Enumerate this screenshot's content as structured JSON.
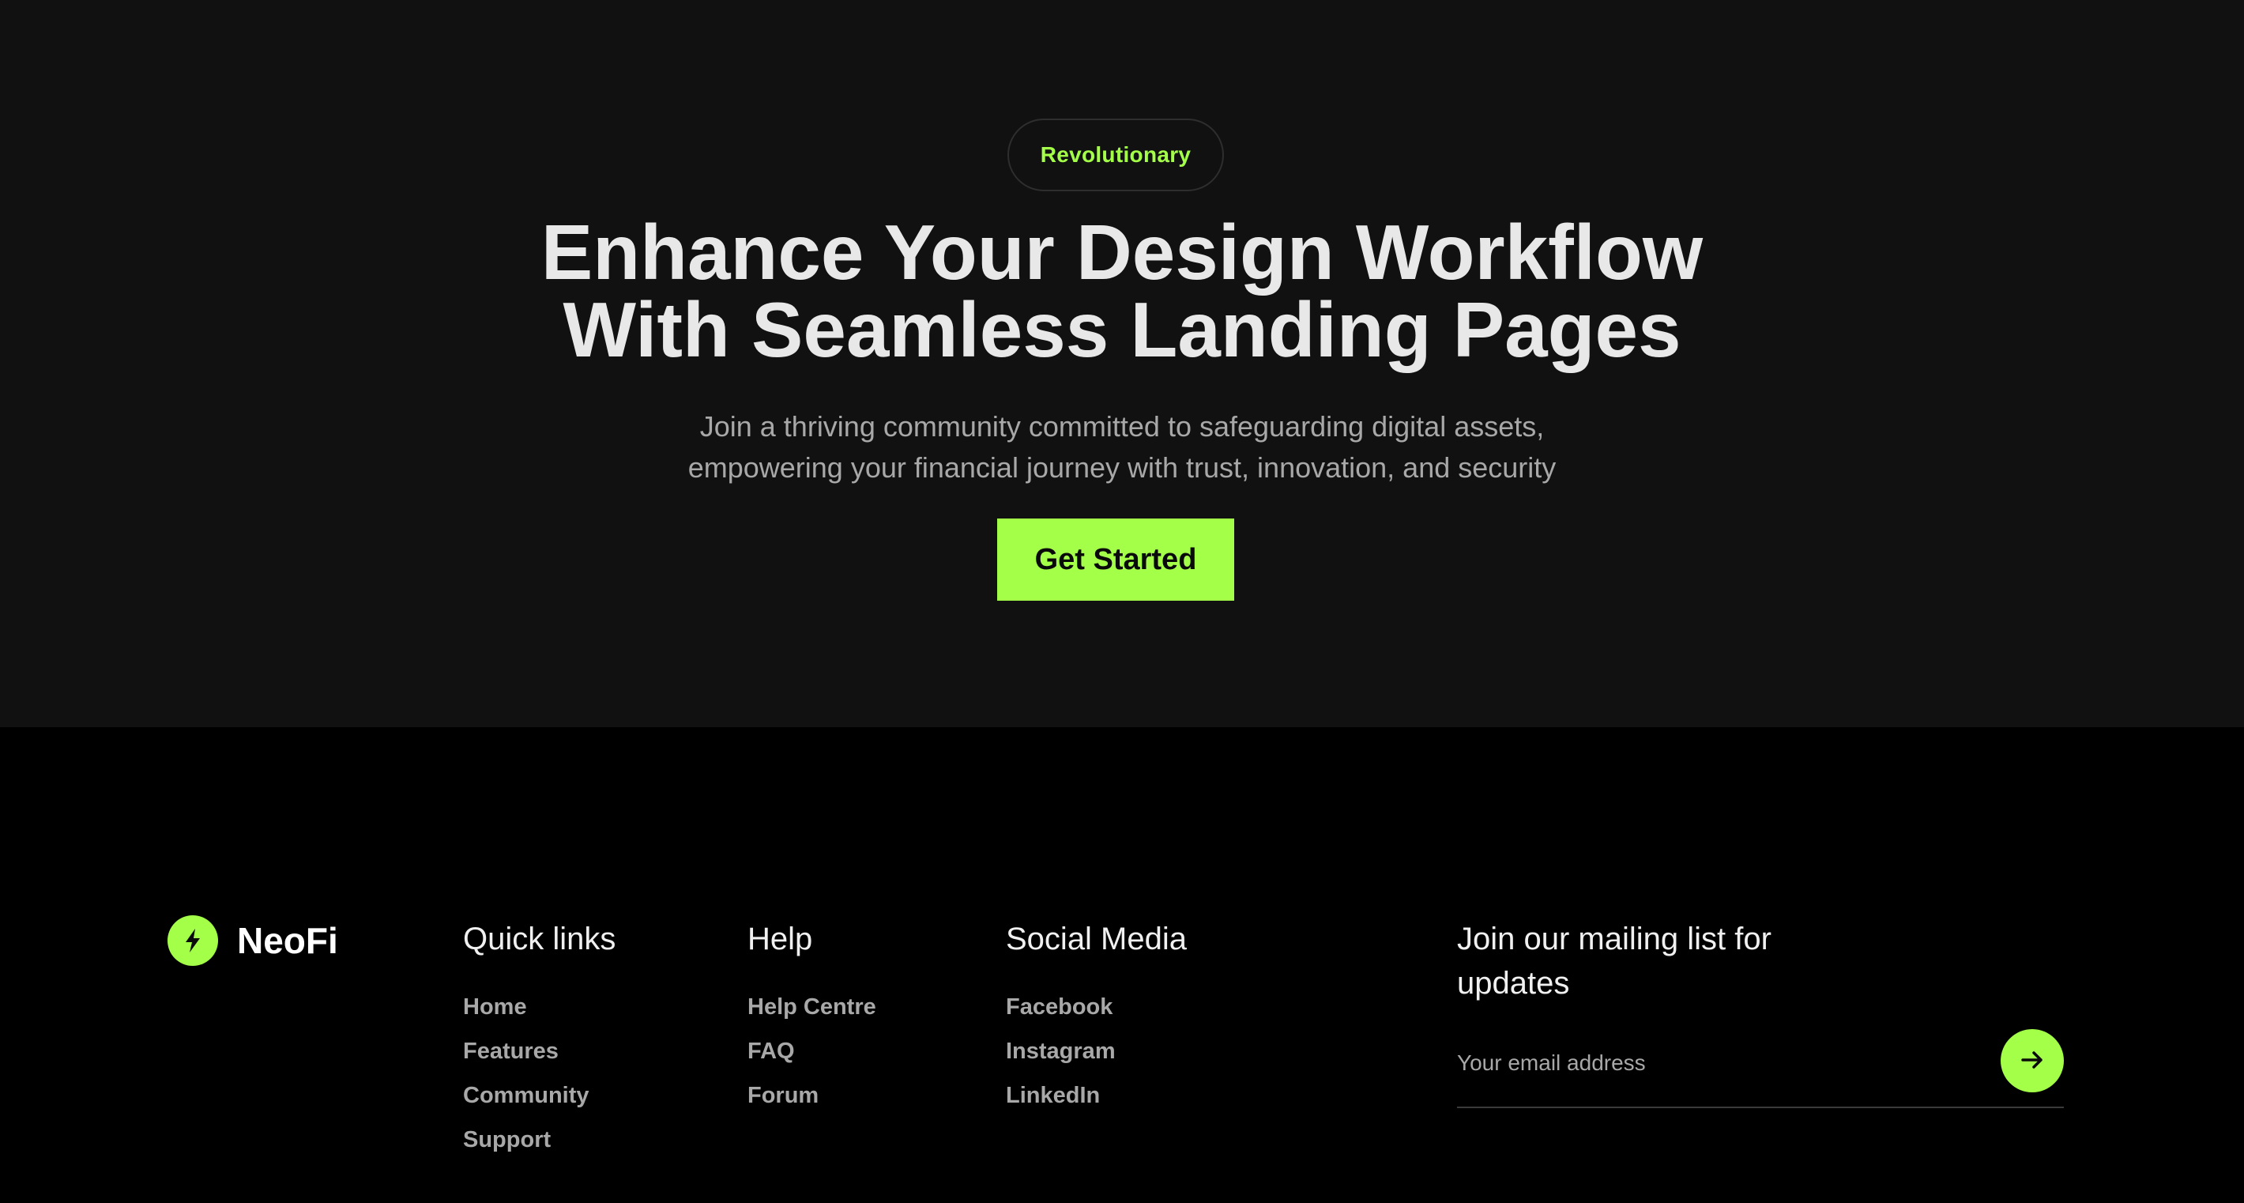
{
  "hero": {
    "badge": "Revolutionary",
    "headline_line1": "Enhance Your Design Workflow",
    "headline_line2": "With Seamless Landing Pages",
    "subtitle_line1": "Join a thriving community committed to safeguarding digital assets,",
    "subtitle_line2": "empowering your financial journey with trust, innovation, and security",
    "cta_label": "Get Started"
  },
  "footer": {
    "brand": {
      "name": "NeoFi",
      "icon": "lightning-bolt-icon"
    },
    "columns": [
      {
        "title": "Quick links",
        "links": [
          "Home",
          "Features",
          "Community",
          "Support"
        ]
      },
      {
        "title": "Help",
        "links": [
          "Help Centre",
          "FAQ",
          "Forum"
        ]
      },
      {
        "title": "Social Media",
        "links": [
          "Facebook",
          "Instagram",
          "LinkedIn"
        ]
      }
    ],
    "mailing": {
      "title": "Join our mailing list for updates",
      "placeholder": "Your email address",
      "submit_icon": "arrow-right-icon"
    }
  },
  "colors": {
    "accent": "#a3ff47",
    "hero_bg": "#111111",
    "footer_bg": "#000000"
  }
}
